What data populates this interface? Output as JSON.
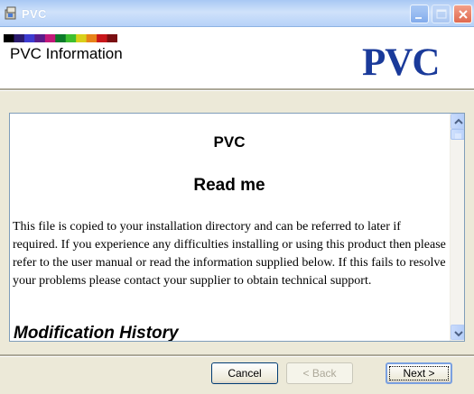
{
  "window": {
    "title": "PVC"
  },
  "header": {
    "title": "PVC Information",
    "logo_text": "PVC",
    "colors": {
      "logo": "#1a3a9a",
      "strip": [
        "#000000",
        "#2b1b6e",
        "#3d3bd0",
        "#5a1c8a",
        "#c2197a",
        "#0b7a2a",
        "#3fbf2f",
        "#d9d01a",
        "#e8831a",
        "#c9171b",
        "#7a0f12"
      ]
    }
  },
  "document": {
    "heading1": "PVC",
    "heading2": "Read me",
    "paragraph": "This file is copied to your installation directory and can be referred to later if required. If you experience any difficulties installing or using this product then please refer to the user manual or read the information supplied below. If this fails to resolve your problems please contact your supplier to obtain technical support.",
    "section_heading": "Modification History"
  },
  "buttons": {
    "cancel": "Cancel",
    "back": "< Back",
    "next": "Next >"
  }
}
